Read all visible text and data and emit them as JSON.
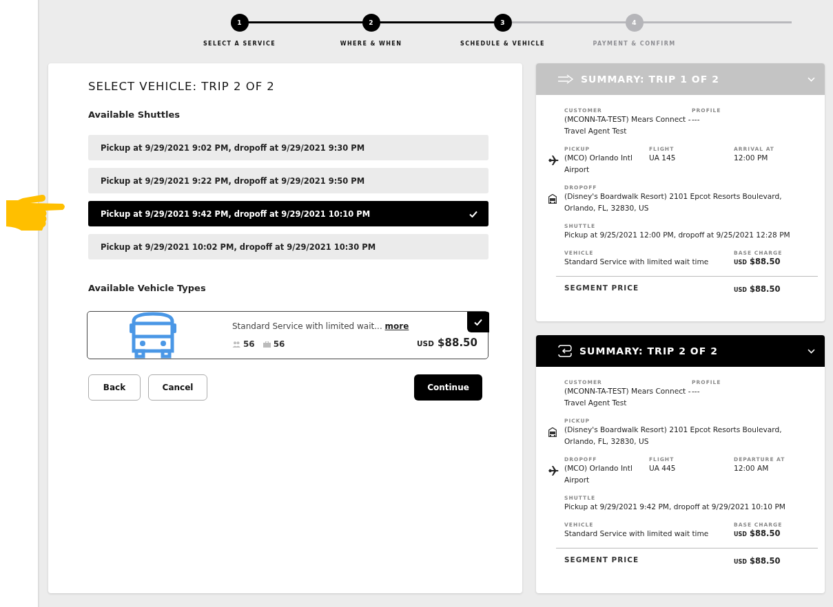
{
  "steps": [
    {
      "number": "1",
      "label": "SELECT A SERVICE",
      "completed": true
    },
    {
      "number": "2",
      "label": "WHERE & WHEN",
      "completed": true
    },
    {
      "number": "3",
      "label": "SCHEDULE & VEHICLE",
      "completed": true
    },
    {
      "number": "4",
      "label": "PAYMENT & CONFIRM",
      "completed": false
    }
  ],
  "vehicle_panel": {
    "title": "SELECT VEHICLE: TRIP 2 OF 2",
    "shuttles_heading": "Available Shuttles",
    "shuttles": [
      {
        "label": "Pickup at 9/29/2021 9:02 PM, dropoff at 9/29/2021 9:30 PM",
        "selected": false
      },
      {
        "label": "Pickup at 9/29/2021 9:22 PM, dropoff at 9/29/2021 9:50 PM",
        "selected": false
      },
      {
        "label": "Pickup at 9/29/2021 9:42 PM, dropoff at 9/29/2021 10:10 PM",
        "selected": true
      },
      {
        "label": "Pickup at 9/29/2021 10:02 PM, dropoff at 9/29/2021 10:30 PM",
        "selected": false
      }
    ],
    "vehicle_types_heading": "Available Vehicle Types",
    "vehicles": [
      {
        "description": "Standard Service with limited wait...",
        "more_link": "more",
        "passengers": "56",
        "bags": "56",
        "currency": "USD",
        "price": "$88.50",
        "selected": true
      }
    ],
    "buttons": [
      {
        "label": "Back",
        "kind": "secondary"
      },
      {
        "label": "Cancel",
        "kind": "secondary"
      },
      {
        "label": "Continue",
        "kind": "primary"
      }
    ]
  },
  "summaries": [
    {
      "title": "SUMMARY: TRIP 1 OF 2",
      "kind": "one-way",
      "active": false,
      "rows": [
        {
          "fields": [
            {
              "label": "CUSTOMER",
              "value": "(MCONN-TA-TEST) Mears Connect - Travel Agent Test"
            },
            {
              "label": "PROFILE",
              "value": "---"
            }
          ]
        },
        {
          "kind": "flight",
          "fields": [
            {
              "label": "PICKUP",
              "value": "(MCO) Orlando Intl Airport"
            },
            {
              "label": "FLIGHT",
              "value": "UA 145"
            },
            {
              "label": "ARRIVAL AT",
              "value": "12:00 PM"
            }
          ]
        },
        {
          "kind": "place",
          "fields": [
            {
              "label": "DROPOFF",
              "value": "(Disney's Boardwalk Resort) 2101 Epcot Resorts Boulevard, Orlando, FL, 32830, US"
            }
          ]
        },
        {
          "fields": [
            {
              "label": "SHUTTLE",
              "value": "Pickup at 9/25/2021 12:00 PM, dropoff at 9/25/2021 12:28 PM"
            }
          ]
        },
        {
          "fields": [
            {
              "label": "VEHICLE",
              "value": "Standard Service with limited wait time"
            },
            {
              "label": "BASE CHARGE",
              "currency": "USD",
              "amount": "$88.50"
            }
          ]
        }
      ],
      "segment": {
        "label": "SEGMENT PRICE",
        "currency": "USD",
        "amount": "$88.50"
      }
    },
    {
      "title": "SUMMARY: TRIP 2 OF 2",
      "kind": "round-trip",
      "active": true,
      "rows": [
        {
          "fields": [
            {
              "label": "CUSTOMER",
              "value": "(MCONN-TA-TEST) Mears Connect - Travel Agent Test"
            },
            {
              "label": "PROFILE",
              "value": "---"
            }
          ]
        },
        {
          "kind": "place",
          "fields": [
            {
              "label": "PICKUP",
              "value": "(Disney's Boardwalk Resort) 2101 Epcot Resorts Boulevard, Orlando, FL, 32830, US"
            }
          ]
        },
        {
          "kind": "flight",
          "fields": [
            {
              "label": "DROPOFF",
              "value": "(MCO) Orlando Intl Airport"
            },
            {
              "label": "FLIGHT",
              "value": "UA 445"
            },
            {
              "label": "DEPARTURE AT",
              "value": "12:00 AM"
            }
          ]
        },
        {
          "fields": [
            {
              "label": "SHUTTLE",
              "value": "Pickup at 9/29/2021 9:42 PM, dropoff at 9/29/2021 10:10 PM"
            }
          ]
        },
        {
          "fields": [
            {
              "label": "VEHICLE",
              "value": "Standard Service with limited wait time"
            },
            {
              "label": "BASE CHARGE",
              "currency": "USD",
              "amount": "$88.50"
            }
          ]
        }
      ],
      "segment": {
        "label": "SEGMENT PRICE",
        "currency": "USD",
        "amount": "$88.50"
      }
    }
  ]
}
